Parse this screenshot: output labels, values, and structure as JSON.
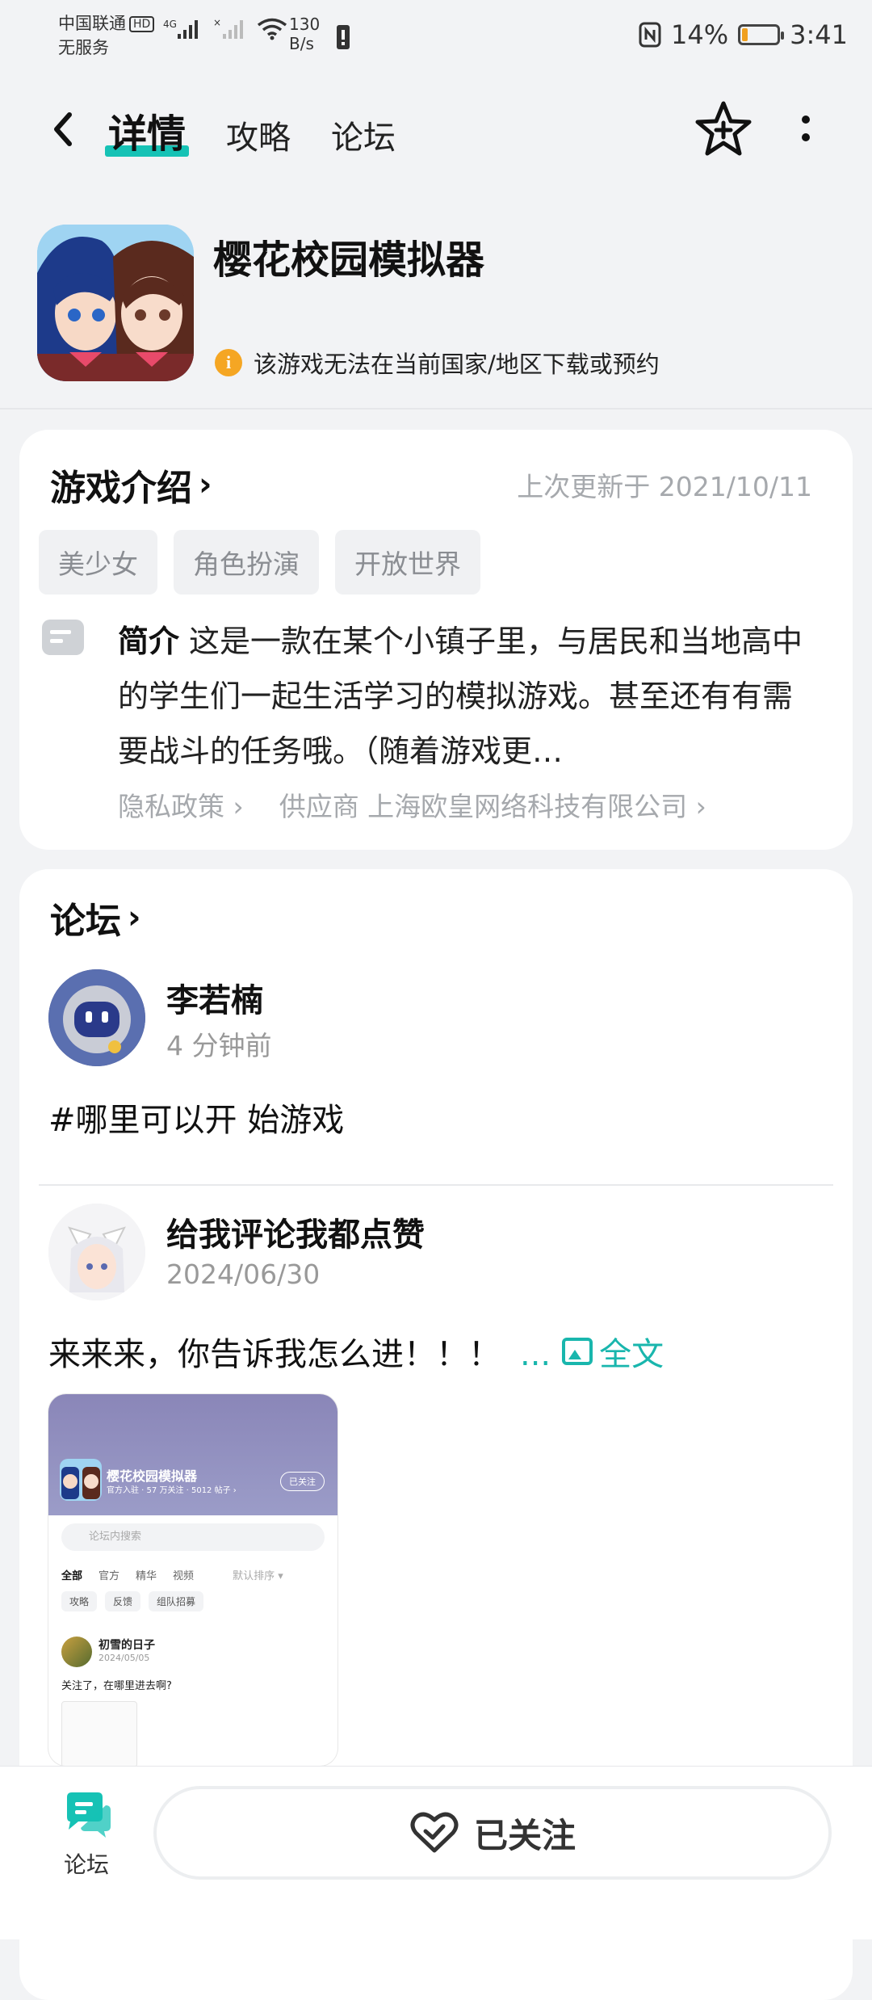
{
  "status_bar": {
    "carrier": "中国联通",
    "hd": "HD",
    "service": "无服务",
    "network": "4G",
    "speed_value": "130",
    "speed_unit": "B/s",
    "battery": "14%",
    "battery_level": 0.14,
    "time": "3:41"
  },
  "header": {
    "tabs": [
      {
        "label": "详情",
        "active": true
      },
      {
        "label": "攻略",
        "active": false
      },
      {
        "label": "论坛",
        "active": false
      }
    ]
  },
  "app": {
    "title": "樱花校园模拟器",
    "notice_icon": "i",
    "notice": "该游戏无法在当前国家/地区下载或预约"
  },
  "intro": {
    "heading": "游戏介绍",
    "chevron": "›",
    "updated": "上次更新于 2021/10/11",
    "tags": [
      "美少女",
      "角色扮演",
      "开放世界"
    ],
    "desc_label": "简介",
    "desc_text": "这是一款在某个小镇子里，与居民和当地高中的学生们一起生活学习的模拟游戏。甚至还有有需要战斗的任务哦。（随着游戏更…",
    "privacy": "隐私政策 ›",
    "vendor": "供应商 上海欧皇网络科技有限公司 ›"
  },
  "forum": {
    "heading": "论坛",
    "chevron": "›",
    "posts": [
      {
        "author": "李若楠",
        "time": "4 分钟前",
        "text": "#哪里可以开 始游戏"
      },
      {
        "author": "给我评论我都点赞",
        "time": "2024/06/30",
        "text": "来来来，你告诉我怎么进！！！",
        "ellipsis": "...",
        "full_text": "全文"
      }
    ],
    "screenshot": {
      "title": "樱花校园模拟器",
      "sub": "官方入驻 · 57 万关注 · 5012 帖子 ›",
      "follow": "已关注",
      "search": "论坛内搜索",
      "tabs": [
        "全部",
        "官方",
        "精华",
        "视频",
        "默认排序 ▾"
      ],
      "chips": [
        "攻略",
        "反馈",
        "组队招募"
      ],
      "user": "初雪的日子",
      "date": "2024/05/05",
      "text": "关注了，在哪里进去啊?"
    }
  },
  "bottom": {
    "forum_label": "论坛",
    "follow_label": "已关注"
  },
  "colors": {
    "accent": "#16c2b5",
    "link": "#19b6ad",
    "warning": "#f5a623"
  }
}
